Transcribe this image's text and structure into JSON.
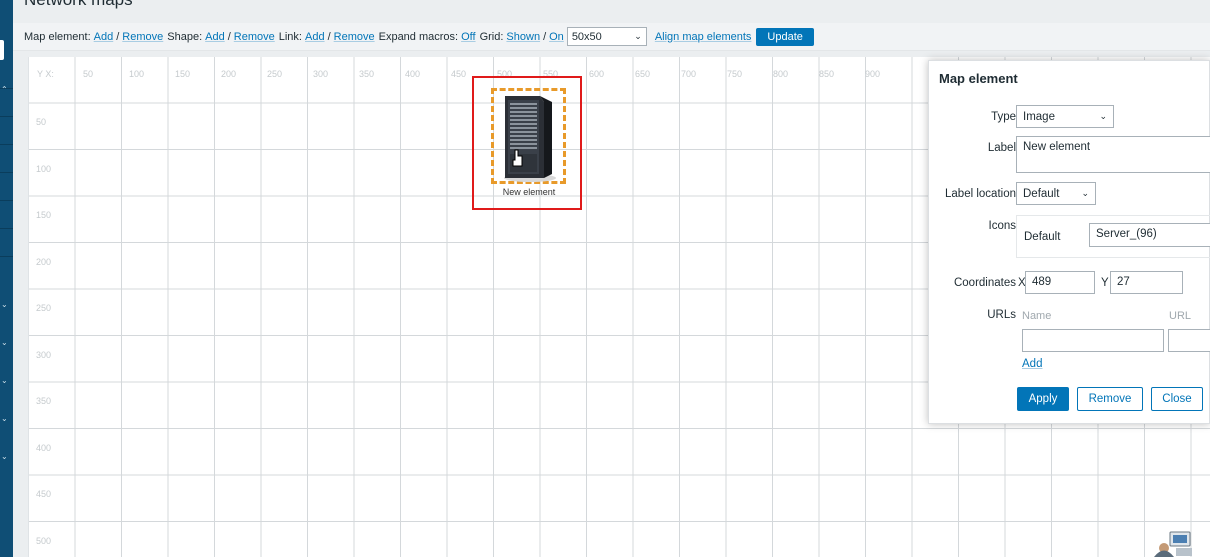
{
  "page_title": "Network maps",
  "toolbar": {
    "map_element_label": "Map element:",
    "shape_label": "Shape:",
    "link_label": "Link:",
    "expand_macros_label": "Expand macros:",
    "grid_label": "Grid:",
    "add": "Add",
    "remove": "Remove",
    "slash": "/",
    "expand_macros_value": "Off",
    "grid_shown": "Shown",
    "grid_on": "On",
    "grid_size": "50x50",
    "align_label": "Align map elements",
    "update_label": "Update"
  },
  "grid": {
    "x_ticks": [
      "Y X:",
      "50",
      "100",
      "150",
      "200",
      "250",
      "300",
      "350",
      "400",
      "450",
      "500",
      "550",
      "600",
      "650",
      "700",
      "750",
      "800",
      "850",
      "900"
    ],
    "y_ticks": [
      "50",
      "100",
      "150",
      "200",
      "250",
      "300",
      "350",
      "400",
      "450",
      "500"
    ]
  },
  "map_element": {
    "label": "New element",
    "icon": "server-icon"
  },
  "panel": {
    "title": "Map element",
    "type_label": "Type",
    "type_value": "Image",
    "label_label": "Label",
    "label_value": "New element",
    "label_location_label": "Label location",
    "label_location_value": "Default",
    "icons_label": "Icons",
    "icons_default_label": "Default",
    "icons_default_value": "Server_(96)",
    "coordinates_label": "Coordinates",
    "x_label": "X",
    "x_value": "489",
    "y_label": "Y",
    "y_value": "27",
    "urls_label": "URLs",
    "urls_name_header": "Name",
    "urls_url_header": "URL",
    "urls_add": "Add",
    "apply": "Apply",
    "remove": "Remove",
    "close": "Close"
  },
  "colors": {
    "accent": "#0275b8",
    "selection_border": "#e01a1a",
    "element_dash": "#e89a2a",
    "sidebar": "#0f4e75"
  }
}
